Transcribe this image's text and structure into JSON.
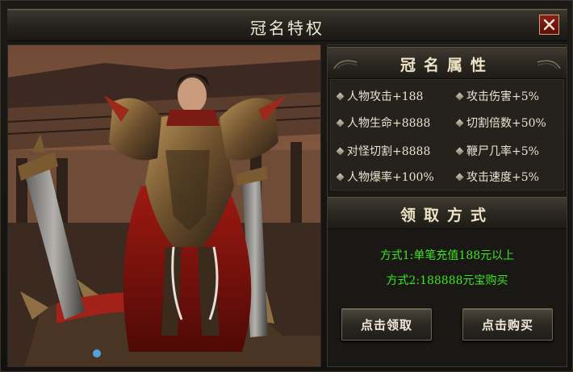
{
  "window": {
    "title": "冠名特权",
    "close_icon": "close-icon"
  },
  "attributes": {
    "title": "冠名属性",
    "items": [
      "人物攻击+188",
      "攻击伤害+5%",
      "人物生命+8888",
      "切割倍数+50%",
      "对怪切割+8888",
      "鞭尸几率+5%",
      "人物爆率+100%",
      "攻击速度+5%"
    ]
  },
  "acquire": {
    "title": "领取方式",
    "methods": [
      "方式1:单笔充值188元以上",
      "方式2:188888元宝购买"
    ],
    "method_color": "#3ce61c"
  },
  "buttons": {
    "claim_label": "点击领取",
    "buy_label": "点击购买"
  },
  "colors": {
    "panel_bg": "#1a1815",
    "close_red": "#8f1e15",
    "text": "#ece3cf"
  }
}
